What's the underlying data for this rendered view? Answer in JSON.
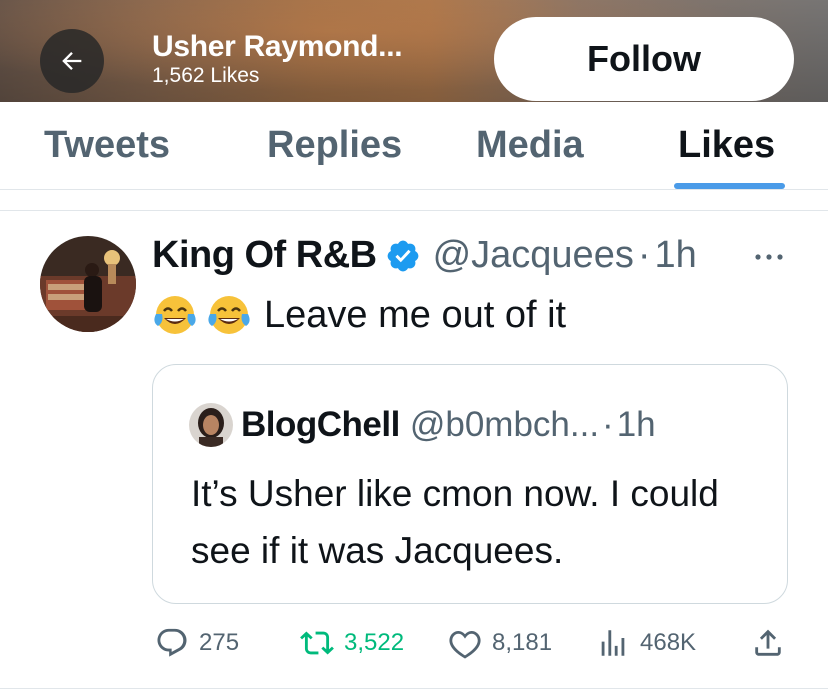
{
  "header": {
    "title": "Usher Raymond...",
    "subtitle": "1,562 Likes",
    "follow_label": "Follow"
  },
  "tabs": [
    {
      "label": "Tweets",
      "active": false
    },
    {
      "label": "Replies",
      "active": false
    },
    {
      "label": "Media",
      "active": false
    },
    {
      "label": "Likes",
      "active": true
    }
  ],
  "tweet": {
    "name": "King Of R&B",
    "verified": true,
    "handle": "@Jacquees",
    "time": "1h",
    "text": "Leave me out of it",
    "emojis": [
      "face-with-tears-of-joy",
      "face-with-tears-of-joy"
    ]
  },
  "quote": {
    "name": "BlogChell",
    "handle": "@b0mbch...",
    "time": "1h",
    "text": "It’s Usher like cmon now. I could see if it was Jacquees."
  },
  "actions": {
    "replies": "275",
    "retweets": "3,522",
    "likes": "8,181",
    "views": "468K"
  },
  "colors": {
    "accent": "#1d9bf0",
    "retweet_active": "#00ba7c",
    "secondary_text": "#536471"
  }
}
